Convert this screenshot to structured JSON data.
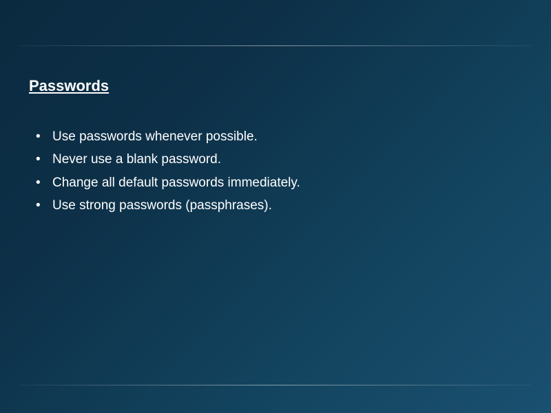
{
  "slide": {
    "heading": "Passwords",
    "bullets": [
      "Use passwords whenever possible.",
      "Never use a blank password.",
      "Change all default passwords immediately.",
      "Use strong passwords (passphrases)."
    ]
  }
}
